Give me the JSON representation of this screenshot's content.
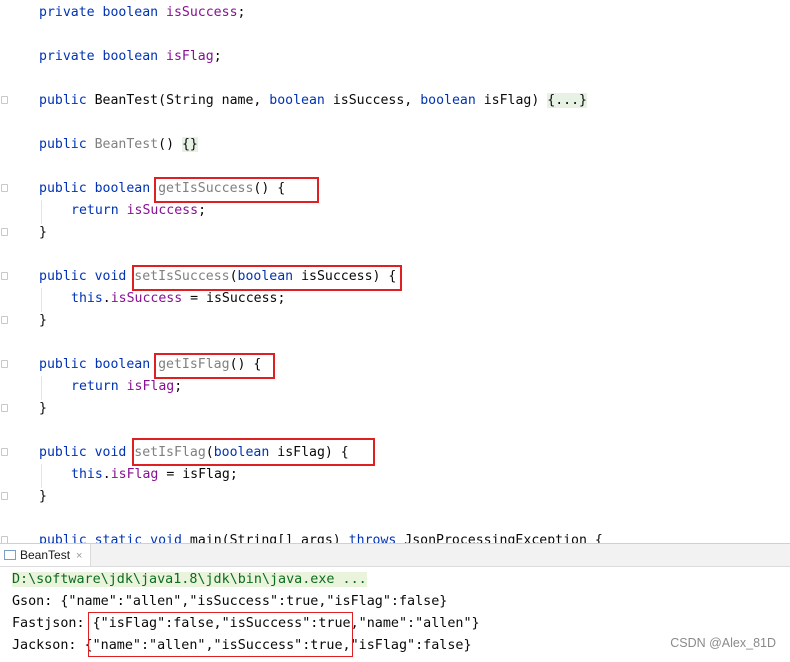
{
  "editor": {
    "l1": {
      "kw": "private boolean",
      "name": "isSuccess",
      "semi": ";"
    },
    "l2": {
      "kw": "private boolean",
      "name": "isFlag",
      "semi": ";"
    },
    "l3": {
      "kw1": "public",
      "cls": "BeanTest",
      "p1": "(String name,",
      "kw2": "boolean",
      "p2": "isSuccess,",
      "kw3": "boolean",
      "p3": "isFlag)",
      "fold": "{...}"
    },
    "l4": {
      "kw": "public",
      "cls": "BeanTest",
      "paren": "()",
      "fold": "{}"
    },
    "l5": {
      "kw": "public boolean",
      "name": "getIsSuccess",
      "rest": "() {"
    },
    "l6": {
      "kw": "return",
      "field": "isSuccess",
      "semi": ";"
    },
    "l7": {
      "text": "}"
    },
    "l8": {
      "kw": "public void",
      "name": "setIsSuccess",
      "open": "(",
      "kw2": "boolean",
      "rest": "isSuccess) {"
    },
    "l9": {
      "kw": "this",
      "dot": ".",
      "field": "isSuccess",
      "rest": "= isSuccess;"
    },
    "l10": {
      "text": "}"
    },
    "l11": {
      "kw": "public boolean",
      "name": "getIsFlag",
      "rest": "() {"
    },
    "l12": {
      "kw": "return",
      "field": "isFlag",
      "semi": ";"
    },
    "l13": {
      "text": "}"
    },
    "l14": {
      "kw": "public void",
      "name": "setIsFlag",
      "open": "(",
      "kw2": "boolean",
      "rest": "isFlag) {"
    },
    "l15": {
      "kw": "this",
      "dot": ".",
      "field": "isFlag",
      "rest": "= isFlag;"
    },
    "l16": {
      "text": "}"
    },
    "l17": {
      "kw": "public static void",
      "rest": "main(String[] args)",
      "kw2": "throws",
      "rest2": "JsonProcessingException {"
    }
  },
  "run_tab": {
    "label": "BeanTest",
    "close": "×"
  },
  "console": {
    "cmd": "D:\\software\\jdk\\java1.8\\jdk\\bin\\java.exe ...",
    "gson": "Gson: {\"name\":\"allen\",\"isSuccess\":true,\"isFlag\":false}",
    "fastjson": "Fastjson: {\"isFlag\":false,\"isSuccess\":true,\"name\":\"allen\"}",
    "jackson": "Jackson: {\"name\":\"allen\",\"isSuccess\":true,\"isFlag\":false}"
  },
  "watermark": "CSDN @Alex_81D",
  "colors": {
    "keyword": "#0033b3",
    "field": "#871094",
    "annotation_box": "#e02020",
    "console_cmd": "#0b6b1c"
  }
}
